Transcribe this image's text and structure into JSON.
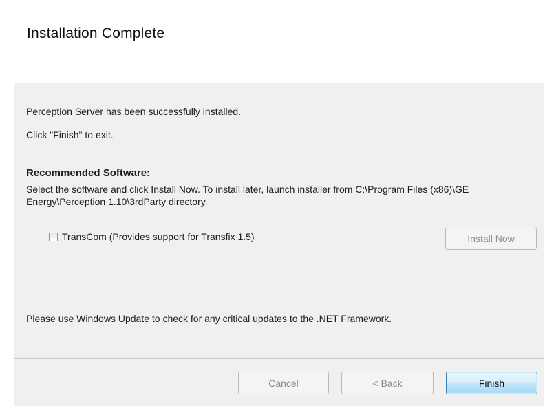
{
  "header": {
    "title": "Installation Complete"
  },
  "body": {
    "success_message": "Perception Server has been successfully installed.",
    "exit_hint": "Click \"Finish\" to exit.",
    "recommended": {
      "heading": "Recommended Software:",
      "description": "Select the software and click Install Now. To install later, launch installer from C:\\Program Files (x86)\\GE Energy\\Perception 1.10\\3rdParty directory.",
      "items": [
        {
          "label": "TransCom (Provides support for Transfix 1.5)",
          "checked": false
        }
      ],
      "install_button": "Install Now"
    },
    "update_note": "Please use Windows Update to check for any critical updates to the .NET Framework."
  },
  "footer": {
    "cancel_label": "Cancel",
    "back_label": "< Back",
    "finish_label": "Finish"
  }
}
